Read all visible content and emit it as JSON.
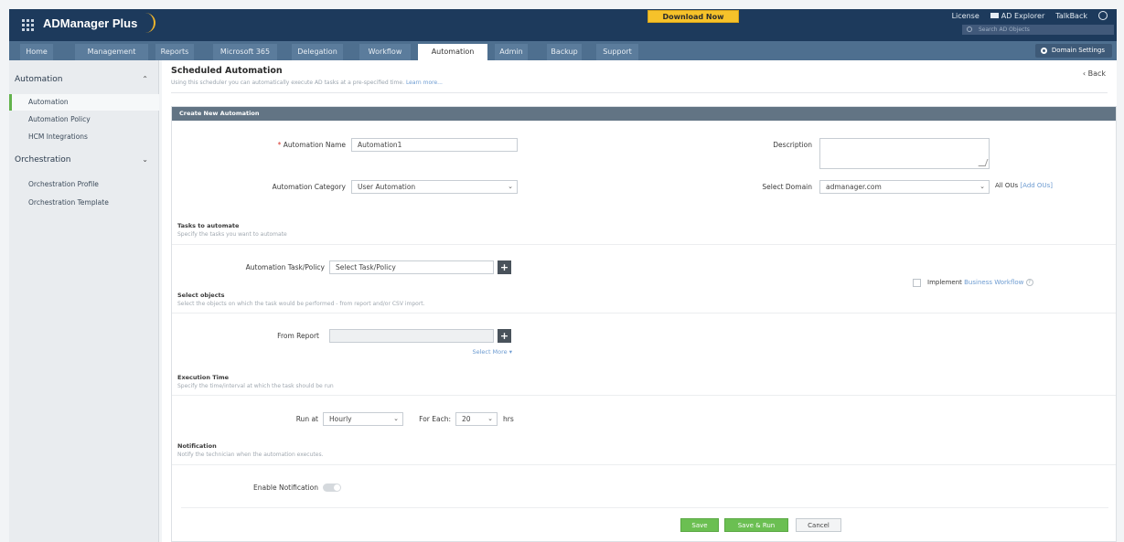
{
  "app": {
    "brand": "ADManager Plus",
    "download_label": "Download Now",
    "top_links": {
      "license": "License",
      "ad_explorer": "AD Explorer",
      "talkback": "TalkBack"
    },
    "search_placeholder": "Search AD Objects"
  },
  "tabs": [
    {
      "label": "Home"
    },
    {
      "label": "Management"
    },
    {
      "label": "Reports"
    },
    {
      "label": "Microsoft 365"
    },
    {
      "label": "Delegation"
    },
    {
      "label": "Workflow"
    },
    {
      "label": "Automation"
    },
    {
      "label": "Admin"
    },
    {
      "label": "Backup"
    },
    {
      "label": "Support"
    }
  ],
  "domain_settings_label": "Domain Settings",
  "sidebar": {
    "sections": [
      {
        "title": "Automation",
        "items": [
          "Automation",
          "Automation Policy",
          "HCM Integrations"
        ]
      },
      {
        "title": "Orchestration",
        "items": [
          "Orchestration Profile",
          "Orchestration Template"
        ]
      }
    ]
  },
  "page": {
    "title": "Scheduled Automation",
    "subtitle": "Using this scheduler you can automatically execute AD tasks at a pre-specified time.",
    "learn_more": "Learn more...",
    "back_label": "Back"
  },
  "form": {
    "panel_title": "Create New Automation",
    "automation_name_label": "Automation Name",
    "automation_name_value": "Automation1",
    "description_label": "Description",
    "category_label": "Automation Category",
    "category_value": "User Automation",
    "domain_label": "Select Domain",
    "domain_value": "admanager.com",
    "all_ous_label": "All OUs",
    "add_ous_link": "[Add OUs]",
    "tasks_title": "Tasks to automate",
    "tasks_sub": "Specify the tasks you want to automate",
    "task_label": "Automation Task/Policy",
    "task_value": "Select Task/Policy",
    "implement_label": "Implement",
    "business_workflow_link": "Business Workflow",
    "objects_title": "Select objects",
    "objects_sub": "Select the objects on which the task would be performed - from report and/or CSV import.",
    "from_report_label": "From Report",
    "select_more": "Select More ▾",
    "exec_title": "Execution Time",
    "exec_sub": "Specify the time/interval at which the task should be run",
    "run_at_label": "Run at",
    "run_at_value": "Hourly",
    "for_each_label": "For Each:",
    "for_each_value": "20",
    "hrs_label": "hrs",
    "notif_title": "Notification",
    "notif_sub": "Notify the technician when the automation executes.",
    "enable_notif_label": "Enable Notification"
  },
  "buttons": {
    "save": "Save",
    "save_run": "Save & Run",
    "cancel": "Cancel"
  }
}
